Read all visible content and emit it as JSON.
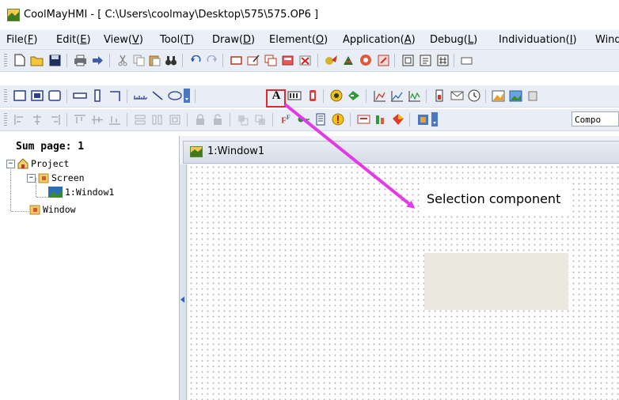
{
  "window": {
    "title": "CoolMayHMI - [ C:\\Users\\coolmay\\Desktop\\575\\575.OP6 ]"
  },
  "menubar": {
    "items": [
      {
        "label": "File(",
        "key": "F",
        "tail": ")"
      },
      {
        "label": "Edit(",
        "key": "E",
        "tail": ")"
      },
      {
        "label": "View(",
        "key": "V",
        "tail": ")"
      },
      {
        "label": "Tool(",
        "key": "T",
        "tail": ")"
      },
      {
        "label": "Draw(",
        "key": "D",
        "tail": ")"
      },
      {
        "label": "Element(",
        "key": "O",
        "tail": ")"
      },
      {
        "label": "Application(",
        "key": "A",
        "tail": ")"
      },
      {
        "label": "Debug(",
        "key": "L",
        "tail": ")"
      },
      {
        "label": "Individuation(",
        "key": "I",
        "tail": ")"
      },
      {
        "label": "Wind",
        "key": "",
        "tail": ""
      }
    ]
  },
  "toolbar3": {
    "combo_text": "Compo"
  },
  "sidebar": {
    "sum_page": "Sum page: 1",
    "tree": {
      "project": "Project",
      "screen": "Screen",
      "window1": "1:Window1",
      "window": "Window"
    }
  },
  "editor": {
    "tab_title": "1:Window1"
  },
  "annotation": {
    "callout_text": "Selection component",
    "highlighted_tool": "A",
    "arrow_color": "#e23ae8",
    "highlight_color": "#e8242d"
  }
}
